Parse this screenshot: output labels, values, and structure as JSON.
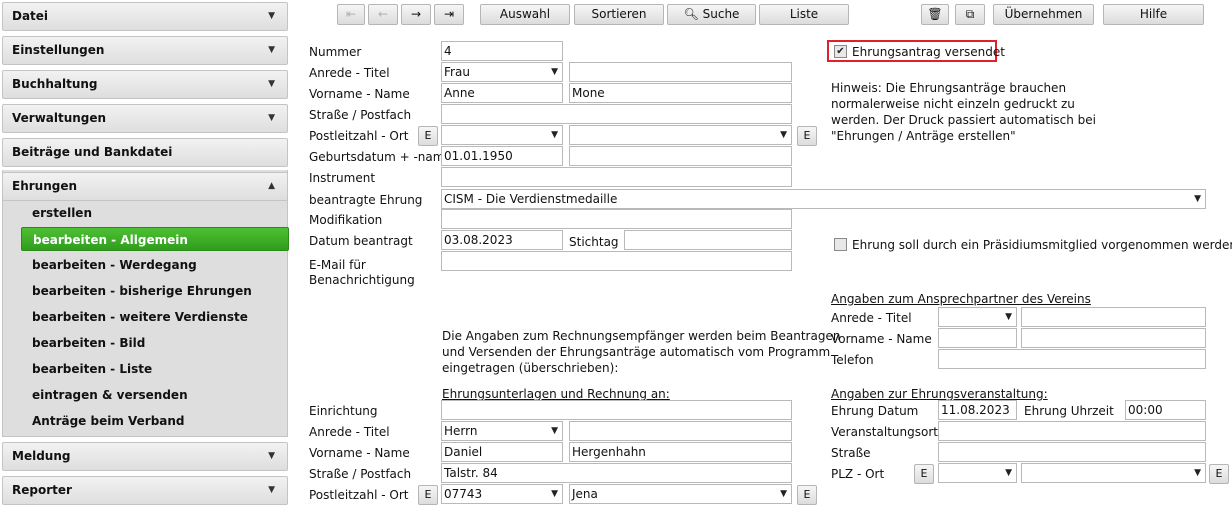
{
  "sidebar": {
    "sections_top": [
      "Datei",
      "Einstellungen",
      "Buchhaltung",
      "Verwaltungen"
    ],
    "beitraege": "Beiträge und Bankdatei",
    "ehrungen": "Ehrungen",
    "ehrungen_items": [
      "erstellen",
      "bearbeiten - Allgemein",
      "bearbeiten - Werdegang",
      "bearbeiten - bisherige Ehrungen",
      "bearbeiten - weitere Verdienste",
      "bearbeiten - Bild",
      "bearbeiten - Liste",
      "eintragen & versenden",
      "Anträge beim Verband"
    ],
    "sections_bottom": [
      "Meldung",
      "Reporter"
    ]
  },
  "toolbar": {
    "first": "⇤",
    "prev": "←",
    "next": "→",
    "last": "⇥",
    "auswahl": "Auswahl",
    "sortieren": "Sortieren",
    "suche": "Suche",
    "liste": "Liste",
    "delete_icon": "🗑",
    "copy_icon": "⧉",
    "uebernehmen": "Übernehmen",
    "hilfe": "Hilfe"
  },
  "form": {
    "nummer_label": "Nummer",
    "nummer": "4",
    "anrede_label": "Anrede - Titel",
    "anrede": "Frau",
    "titel": "",
    "name_label": "Vorname - Name",
    "vorname": "Anne",
    "name": "Mone",
    "strasse_label": "Straße / Postfach",
    "strasse": "",
    "plz_label": "Postleitzahl - Ort",
    "plz": "",
    "ort": "",
    "geb_label": "Geburtsdatum + -name",
    "geburtsdatum": "01.01.1950",
    "geburtsname": "",
    "instrument_label": "Instrument",
    "instrument": "",
    "ehrung_label": "beantragte Ehrung",
    "ehrung": "CISM - Die Verdienstmedaille",
    "modifikation_label": "Modifikation",
    "modifikation": "",
    "datum_label": "Datum beantragt",
    "datum": "03.08.2023",
    "stichtag_label": "Stichtag",
    "stichtag": "",
    "email_label_1": "E-Mail für",
    "email_label_2": "Benachrichtigung",
    "email": "",
    "e_button": "E"
  },
  "right": {
    "versendet_label": "Ehrungsantrag versendet",
    "hinweis": [
      "Hinweis: Die Ehrungsanträge brauchen",
      "normalerweise nicht einzeln gedruckt zu",
      "werden. Der Druck passiert automatisch bei",
      "\"Ehrungen / Anträge erstellen\""
    ],
    "praesidium_label": "Ehrung soll durch ein Präsidiumsmitglied vorgenommen werden"
  },
  "rechnung": {
    "info": [
      "Die Angaben zum Rechnungsempfänger werden beim Beantragen",
      "und Versenden der Ehrungsanträge automatisch vom Programm",
      "eingetragen (überschrieben):"
    ],
    "heading": "Ehrungsunterlagen und Rechnung an:",
    "einrichtung_label": "Einrichtung",
    "einrichtung": "",
    "anrede_label": "Anrede - Titel",
    "anrede": "Herrn",
    "titel": "",
    "name_label": "Vorname - Name",
    "vorname": "Daniel",
    "name": "Hergenhahn",
    "strasse_label": "Straße / Postfach",
    "strasse": "Talstr. 84",
    "plz_label": "Postleitzahl - Ort",
    "plz": "07743",
    "ort": "Jena"
  },
  "ansprech": {
    "heading": "Angaben zum Ansprechpartner des Vereins",
    "anrede_label": "Anrede - Titel",
    "anrede": "",
    "titel": "",
    "name_label": "Vorname - Name",
    "vorname": "",
    "name": "",
    "telefon_label": "Telefon",
    "telefon": ""
  },
  "veranstaltung": {
    "heading": "Angaben zur Ehrungsveranstaltung:",
    "datum_label": "Ehrung Datum",
    "datum": "11.08.2023",
    "uhrzeit_label": "Ehrung Uhrzeit",
    "uhrzeit": "00:00",
    "ort_label": "Veranstaltungsort",
    "ort": "",
    "strasse_label": "Straße",
    "strasse": "",
    "plz_label": "PLZ - Ort",
    "plz": "",
    "ortname": ""
  },
  "colors": {
    "active_green": "#3aad26",
    "highlight_red": "#e0202a"
  }
}
